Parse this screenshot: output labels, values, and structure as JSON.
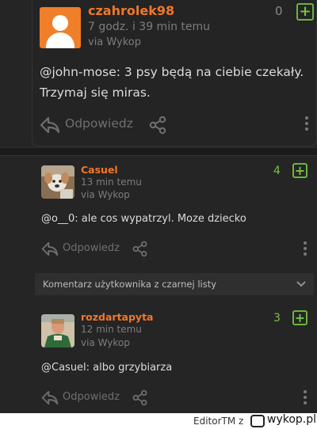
{
  "comments": [
    {
      "username": "czahrolek98",
      "time": "7 godz. i 39 min temu",
      "via": "via Wykop",
      "votes": "0",
      "body_line1": "@john-mose: 3 psy będą na ciebie czekały.",
      "body_line2": "Trzymaj się miras.",
      "reply_label": "Odpowiedz"
    },
    {
      "username": "Casuel",
      "time": "13 min temu",
      "via": "via Wykop",
      "votes": "4",
      "body": "@o__0: ale cos wypatrzyl. Moze dziecko",
      "reply_label": "Odpowiedz"
    },
    {
      "username": "rozdartapyta",
      "time": "12 min temu",
      "via": "via Wykop",
      "votes": "3",
      "body": "@Casuel: albo grzybiarza",
      "reply_label": "Odpowiedz"
    }
  ],
  "blacklist_notice": "Komentarz użytkownika z czarnej listy",
  "footer": {
    "author": "EditorTM",
    "separator": "z",
    "site": "wykop.pl"
  },
  "colors": {
    "username": "#f0772a",
    "plus": "#7ac143",
    "background": "#252525"
  },
  "icons": [
    "reply-icon",
    "share-icon",
    "plus-icon",
    "more-icon",
    "chevron-down-icon"
  ]
}
